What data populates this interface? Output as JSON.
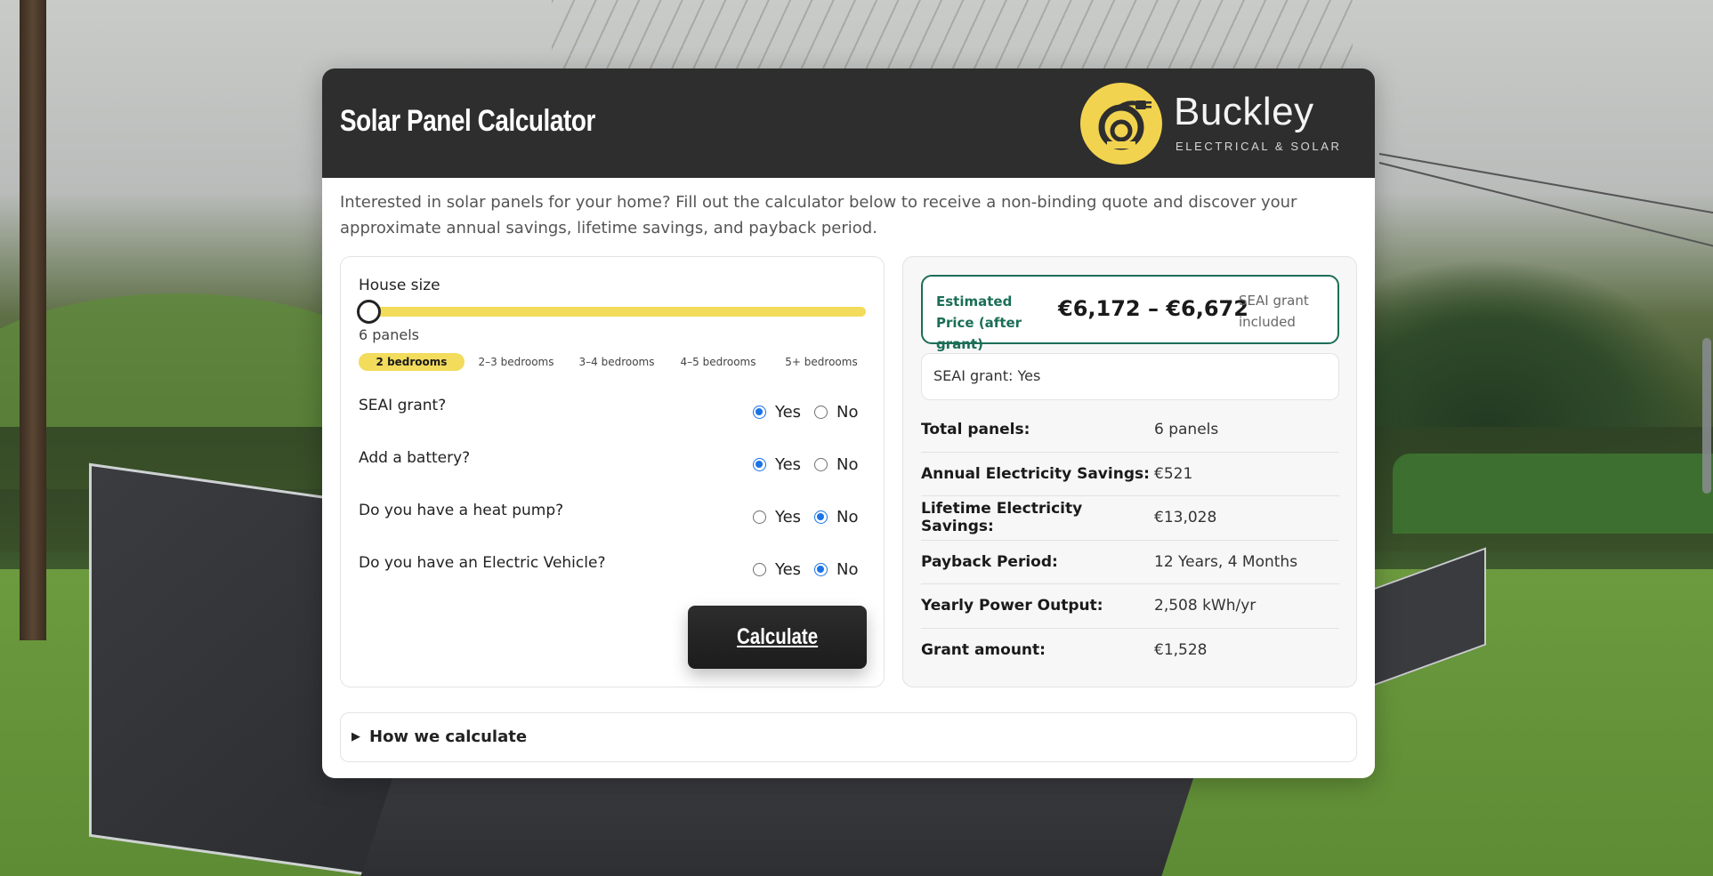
{
  "header": {
    "title": "Solar Panel Calculator",
    "logo_name": "Buckley",
    "logo_subtitle": "ELECTRICAL & SOLAR"
  },
  "intro": "Interested in solar panels for your home? Fill out the calculator below to receive a non-binding quote and discover your approximate annual savings, lifetime savings, and payback period.",
  "form": {
    "house_size_label": "House size",
    "panels_readout": "6 panels",
    "slider_level": 0,
    "bedrooms": [
      "2 bedrooms",
      "2–3 bedrooms",
      "3–4 bedrooms",
      "4–5 bedrooms",
      "5+ bedrooms"
    ],
    "selected_bedroom_index": 0,
    "questions": [
      {
        "label": "SEAI grant?",
        "yes": "Yes",
        "no": "No",
        "selected": "yes"
      },
      {
        "label": "Add a battery?",
        "yes": "Yes",
        "no": "No",
        "selected": "yes"
      },
      {
        "label": "Do you have a heat pump?",
        "yes": "Yes",
        "no": "No",
        "selected": "no"
      },
      {
        "label": "Do you have an Electric Vehicle?",
        "yes": "Yes",
        "no": "No",
        "selected": "no"
      }
    ],
    "calculate_label": "Calculate"
  },
  "result": {
    "price_label": "Estimated Price (after grant)",
    "price_value": "€6,172 – €6,672",
    "price_note": "SEAI grant included",
    "grant_status": "SEAI grant: Yes",
    "stats": [
      {
        "key": "Total panels:",
        "value": "6 panels"
      },
      {
        "key": "Annual Electricity Savings:",
        "value": "€521"
      },
      {
        "key": "Lifetime Electricity Savings:",
        "value": "€13,028"
      },
      {
        "key": "Payback Period:",
        "value": "12 Years, 4 Months"
      },
      {
        "key": "Yearly Power Output:",
        "value": "2,508 kWh/yr"
      },
      {
        "key": "Grant amount:",
        "value": "€1,528"
      }
    ]
  },
  "how": {
    "label": "How we calculate"
  },
  "colors": {
    "header_bg": "#2e2e2e",
    "accent_yellow": "#f3db5c",
    "price_green": "#1b6e57",
    "radio_blue": "#1a73e8"
  }
}
